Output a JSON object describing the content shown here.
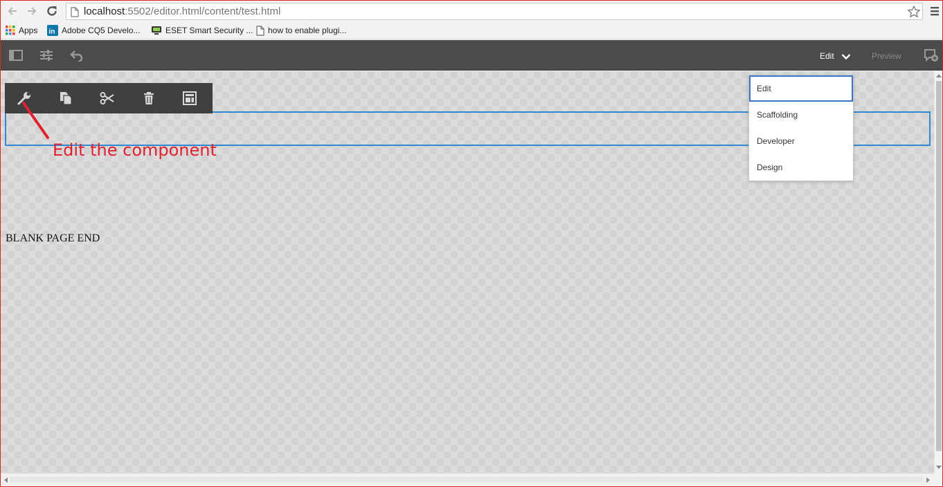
{
  "browser": {
    "url_host": "localhost",
    "url_rest": ":5502/editor.html/content/test.html"
  },
  "bookmarks": [
    {
      "label": "Apps",
      "icon": "apps-grid-icon"
    },
    {
      "label": "Adobe CQ5 Develo...",
      "icon": "linkedin-icon"
    },
    {
      "label": "ESET Smart Security ...",
      "icon": "eset-icon"
    },
    {
      "label": "how to enable plugi...",
      "icon": "page-icon"
    }
  ],
  "editor": {
    "mode_label": "Edit",
    "preview_label": "Preview",
    "left_icons": [
      "side-panel-icon",
      "page-properties-icon",
      "undo-icon"
    ],
    "annotations_icon": "annotations-icon"
  },
  "component_toolbar": {
    "actions": [
      "configure-wrench-icon",
      "copy-icon",
      "cut-icon",
      "delete-icon",
      "group-icon"
    ]
  },
  "annotation": {
    "text": "Edit the component",
    "color": "#e3202d"
  },
  "page": {
    "blank_end": "BLANK PAGE END"
  },
  "mode_menu": {
    "items": [
      "Edit",
      "Scaffolding",
      "Developer",
      "Design"
    ],
    "selected": "Edit"
  },
  "colors": {
    "editor_bar": "#4b4b4b",
    "selection_blue": "#3287d2",
    "window_border": "#e02020"
  }
}
